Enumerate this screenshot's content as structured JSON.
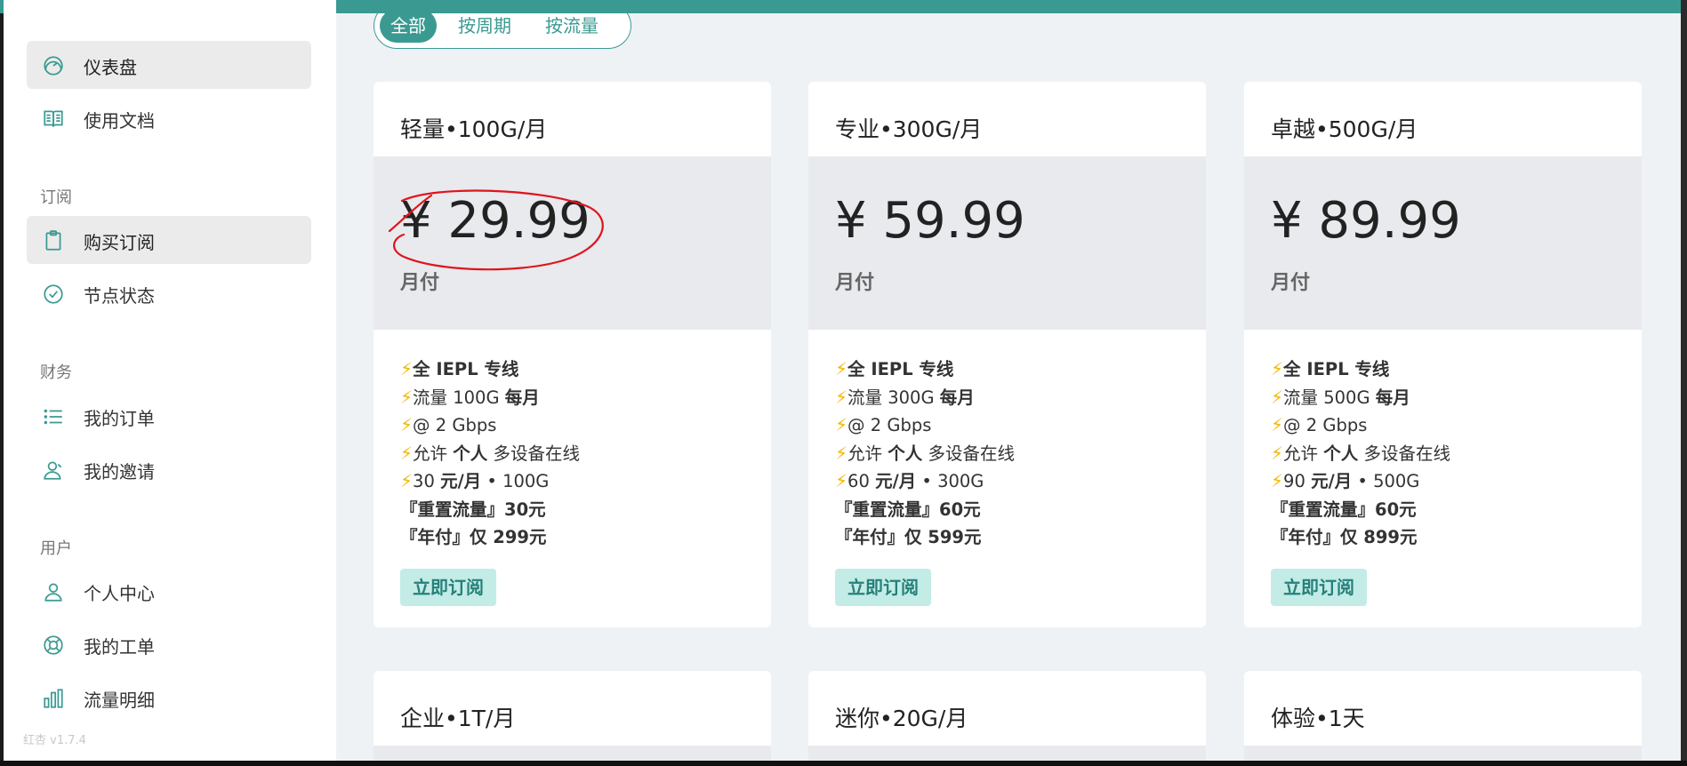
{
  "sidebar": {
    "items_top": [
      {
        "label": "仪表盘",
        "icon": "dashboard-icon"
      },
      {
        "label": "使用文档",
        "icon": "book-icon"
      }
    ],
    "sections": [
      {
        "title": "订阅",
        "items": [
          {
            "label": "购买订阅",
            "icon": "clipboard-icon"
          },
          {
            "label": "节点状态",
            "icon": "check-circle-icon"
          }
        ]
      },
      {
        "title": "财务",
        "items": [
          {
            "label": "我的订单",
            "icon": "list-icon"
          },
          {
            "label": "我的邀请",
            "icon": "user-invite-icon"
          }
        ]
      },
      {
        "title": "用户",
        "items": [
          {
            "label": "个人中心",
            "icon": "user-icon"
          },
          {
            "label": "我的工单",
            "icon": "support-icon"
          },
          {
            "label": "流量明细",
            "icon": "bar-chart-icon"
          }
        ]
      }
    ],
    "version": "红杏 v1.7.4"
  },
  "tabs": [
    {
      "label": "全部",
      "active": true
    },
    {
      "label": "按周期",
      "active": false
    },
    {
      "label": "按流量",
      "active": false
    }
  ],
  "plans": [
    {
      "title": "轻量•100G/月",
      "price": "¥ 29.99",
      "period": "月付",
      "features": {
        "f1a": "全 IEPL ",
        "f1b": "专线",
        "f2a": "流量 100G ",
        "f2b": "每月",
        "f3": "@ 2 Gbps",
        "f4a": "允许 ",
        "f4b": "个人",
        "f4c": " 多设备在线",
        "f5a": "30 ",
        "f5b": "元/月",
        "f5c": " • 100G",
        "f6": "『重置流量』30元",
        "f7": "『年付』仅 299元"
      },
      "button": "立即订阅"
    },
    {
      "title": "专业•300G/月",
      "price": "¥ 59.99",
      "period": "月付",
      "features": {
        "f1a": "全 IEPL ",
        "f1b": "专线",
        "f2a": "流量 300G ",
        "f2b": "每月",
        "f3": "@ 2 Gbps",
        "f4a": "允许 ",
        "f4b": "个人",
        "f4c": " 多设备在线",
        "f5a": "60 ",
        "f5b": "元/月",
        "f5c": " • 300G",
        "f6": "『重置流量』60元",
        "f7": "『年付』仅 599元"
      },
      "button": "立即订阅"
    },
    {
      "title": "卓越•500G/月",
      "price": "¥ 89.99",
      "period": "月付",
      "features": {
        "f1a": "全 IEPL ",
        "f1b": "专线",
        "f2a": "流量 500G ",
        "f2b": "每月",
        "f3": "@ 2 Gbps",
        "f4a": "允许 ",
        "f4b": "个人",
        "f4c": " 多设备在线",
        "f5a": "90 ",
        "f5b": "元/月",
        "f5c": " • 500G",
        "f6": "『重置流量』60元",
        "f7": "『年付』仅 899元"
      },
      "button": "立即订阅"
    }
  ],
  "plans_row2": [
    {
      "title": "企业•1T/月"
    },
    {
      "title": "迷你•20G/月"
    },
    {
      "title": "体验•1天"
    }
  ],
  "colors": {
    "accent": "#3a9a92",
    "button_bg": "#c3ece7",
    "annotation": "#e0141e"
  }
}
